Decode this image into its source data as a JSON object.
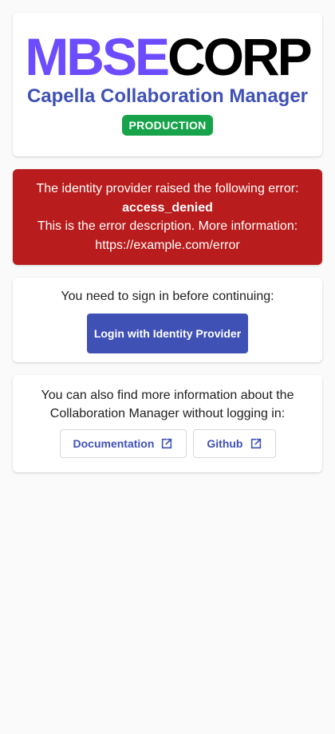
{
  "branding": {
    "logo_part_a": "MBSE",
    "logo_part_b": "CORP",
    "app_title": "Capella Collaboration Manager",
    "environment_badge": "PRODUCTION"
  },
  "error": {
    "intro": "The identity provider raised the following error:",
    "code": "access_denied",
    "description": "This is the error description. More information:",
    "url": "https://example.com/error"
  },
  "signin": {
    "prompt": "You need to sign in before continuing:",
    "login_button": "Login with Identity Provider"
  },
  "info": {
    "text": "You can also find more information about the Collaboration Manager without logging in:",
    "links": {
      "documentation": "Documentation",
      "github": "Github"
    }
  },
  "icons": {
    "external_link": "open-in-new-icon"
  },
  "colors": {
    "primary": "#3f51b5",
    "logo_accent": "#6d4cff",
    "error_background": "#b91c1c",
    "production_badge": "#16a34a",
    "page_background": "#fafafa"
  }
}
